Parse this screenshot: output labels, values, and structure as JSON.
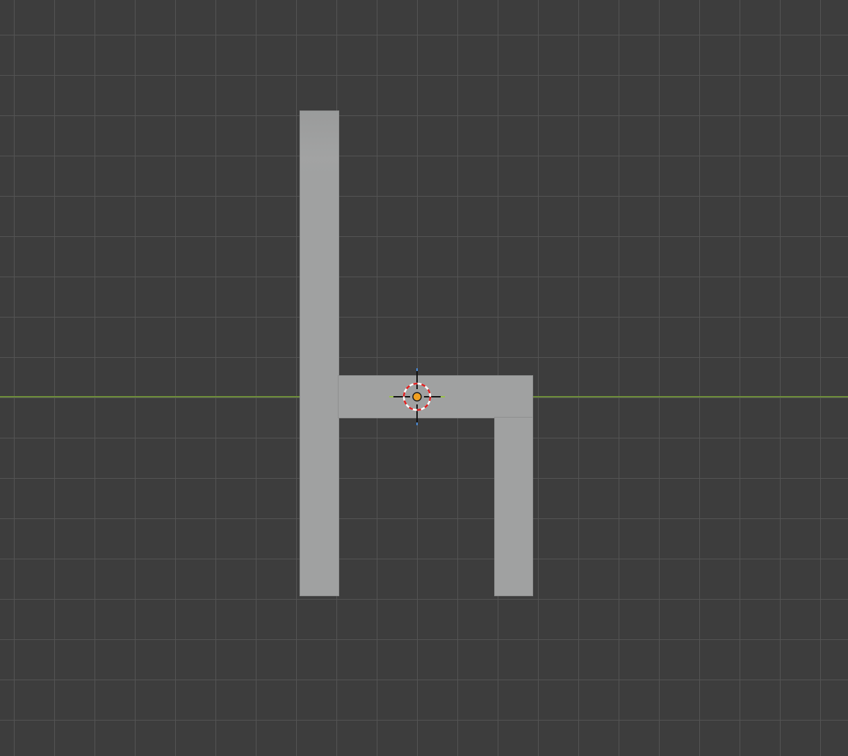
{
  "viewport": {
    "view": "3D viewport",
    "grid_visible": true,
    "background_color": "#3d3d3d",
    "grid_line_color": "#545454",
    "x_axis_color": "#6f8f3a"
  },
  "object": {
    "shape": "chair",
    "color": "#a0a1a1",
    "parts": [
      "chair-back",
      "chair-seat",
      "chair-front-leg"
    ]
  },
  "cursor": {
    "icon": "3d-cursor-icon",
    "origin_color": "#f0a020",
    "ring_colors": [
      "#ffffff",
      "#e02020"
    ]
  }
}
